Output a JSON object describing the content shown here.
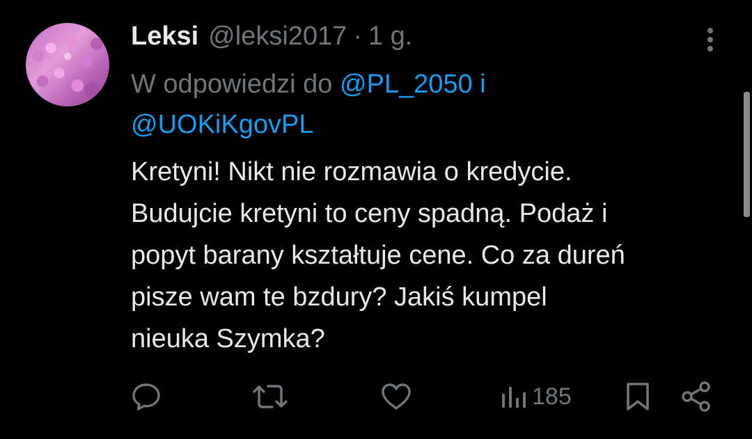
{
  "tweet": {
    "author_name": "Leksi",
    "author_handle": "@leksi2017",
    "separator": "·",
    "timestamp": "1 g.",
    "reply_prefix": "W odpowiedzi do",
    "reply_mention_1": "@PL_2050",
    "reply_conjunction": "i",
    "reply_mention_2": "@UOKiKgovPL",
    "body_lines": [
      "Kretyni! Nikt nie rozmawia o kredycie.",
      "Budujcie kretyni to ceny spadną. Podaż i",
      "popyt barany kształtuje cene. Co za dureń",
      "pisze wam te bzdury? Jakiś kumpel",
      "nieuka Szymka?"
    ],
    "views": "185"
  },
  "icons": {
    "avatar": "avatar-flower-image",
    "more": "more-vertical-icon",
    "reply": "reply-icon",
    "retweet": "retweet-icon",
    "like": "heart-icon",
    "views": "views-chart-icon",
    "bookmark": "bookmark-icon",
    "share": "share-icon"
  },
  "colors": {
    "background": "#000000",
    "text_primary": "#e7e9ea",
    "text_secondary": "#71767b",
    "link": "#1d9bf0"
  }
}
